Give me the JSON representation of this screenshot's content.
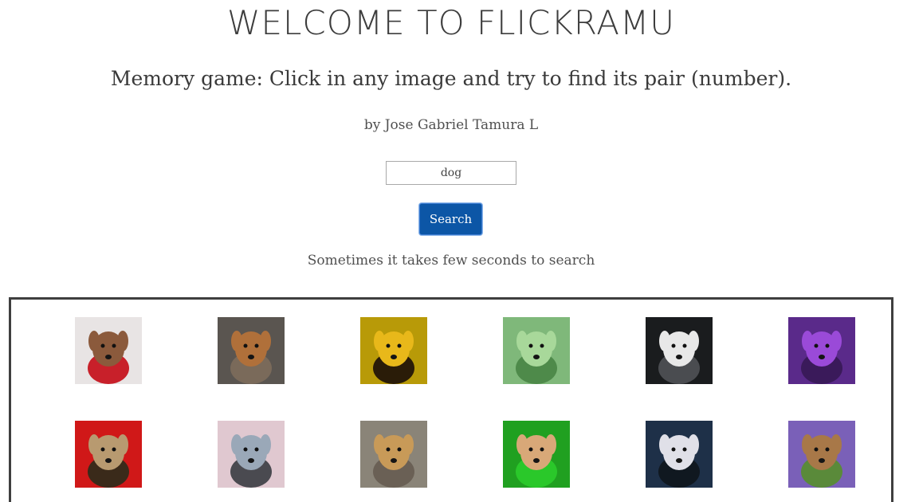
{
  "header": {
    "title": "WELCOME TO FLICKRAMU",
    "subtitle": "Memory game: Click in any image and try to find its pair (number).",
    "author": "by Jose Gabriel Tamura L"
  },
  "search": {
    "value": "dog",
    "button_label": "Search",
    "hint": "Sometimes it takes few seconds to search"
  },
  "board": {
    "rows": [
      [
        {
          "name": "dog-red-sweater-snow",
          "bg": "#e8e4e4",
          "dog": "#8b5a3c",
          "accent": "#c8202a"
        },
        {
          "name": "dog-lying-gravel",
          "bg": "#5a5550",
          "dog": "#b0703a",
          "accent": "#7a6a5a"
        },
        {
          "name": "dog-yellow-lab",
          "bg": "#b89a08",
          "dog": "#e8b81a",
          "accent": "#2a1c08"
        },
        {
          "name": "dog-green-tiles",
          "bg": "#7fb87a",
          "dog": "#a8d89a",
          "accent": "#4e8a4a"
        },
        {
          "name": "dog-husky",
          "bg": "#1a1c1e",
          "dog": "#e8e8e8",
          "accent": "#4a4c50"
        },
        {
          "name": "dog-purple-puppy",
          "bg": "#5a2a8a",
          "dog": "#9a4ad8",
          "accent": "#3a1a5a"
        }
      ],
      [
        {
          "name": "dog-yorkie-red-couch",
          "bg": "#d01818",
          "dog": "#b89a70",
          "accent": "#3a2a1a"
        },
        {
          "name": "dog-merle-puppy",
          "bg": "#e0c8d0",
          "dog": "#9aa8b8",
          "accent": "#4a4a50"
        },
        {
          "name": "dog-shaggy-standing",
          "bg": "#8a8478",
          "dog": "#c89a58",
          "accent": "#6a6055"
        },
        {
          "name": "dog-green-wig",
          "bg": "#20a020",
          "dog": "#d8a878",
          "accent": "#2ac82a"
        },
        {
          "name": "dog-black-white",
          "bg": "#1e3048",
          "dog": "#e0e0e8",
          "accent": "#101820"
        },
        {
          "name": "dog-bluebells",
          "bg": "#7a60b8",
          "dog": "#a87848",
          "accent": "#5a8a3a"
        }
      ]
    ]
  }
}
